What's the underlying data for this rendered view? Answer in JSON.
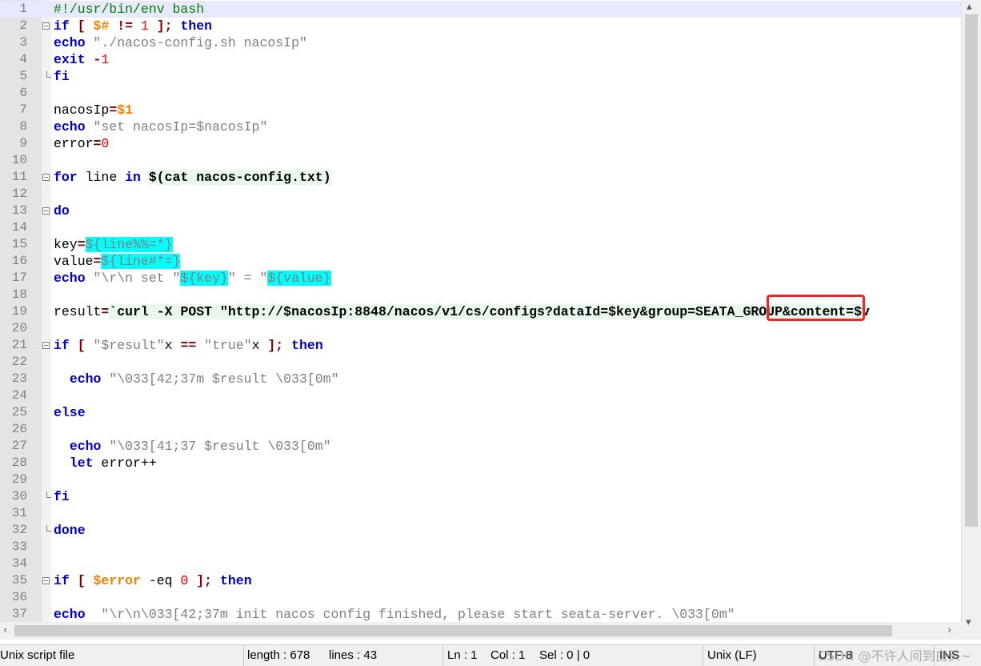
{
  "editor": {
    "lines": [
      {
        "n": "1",
        "tokens": [
          {
            "t": "#!/usr/bin/env bash",
            "c": "cmt"
          }
        ]
      },
      {
        "n": "2",
        "tokens": [
          {
            "t": "if",
            "c": "kw"
          },
          {
            "t": " [ ",
            "c": "op"
          },
          {
            "t": "$#",
            "c": "var"
          },
          {
            "t": " != ",
            "c": "op"
          },
          {
            "t": "1",
            "c": "num"
          },
          {
            "t": " ]; ",
            "c": "op"
          },
          {
            "t": "then",
            "c": "kw"
          }
        ]
      },
      {
        "n": "3",
        "tokens": [
          {
            "t": "echo",
            "c": "kw"
          },
          {
            "t": " \"./nacos-config.sh nacosIp\"",
            "c": "str"
          }
        ]
      },
      {
        "n": "4",
        "tokens": [
          {
            "t": "exit",
            "c": "kw"
          },
          {
            "t": " -",
            "c": "op"
          },
          {
            "t": "1",
            "c": "num"
          }
        ]
      },
      {
        "n": "5",
        "tokens": [
          {
            "t": "fi",
            "c": "kw"
          }
        ]
      },
      {
        "n": "6",
        "tokens": []
      },
      {
        "n": "7",
        "tokens": [
          {
            "t": "nacosIp",
            "c": ""
          },
          {
            "t": "=",
            "c": "op"
          },
          {
            "t": "$1",
            "c": "var"
          }
        ]
      },
      {
        "n": "8",
        "tokens": [
          {
            "t": "echo",
            "c": "kw"
          },
          {
            "t": " \"set nacosIp=$nacosIp\"",
            "c": "str"
          }
        ]
      },
      {
        "n": "9",
        "tokens": [
          {
            "t": "error",
            "c": ""
          },
          {
            "t": "=",
            "c": "op"
          },
          {
            "t": "0",
            "c": "num"
          }
        ]
      },
      {
        "n": "10",
        "tokens": []
      },
      {
        "n": "11",
        "tokens": [
          {
            "t": "for",
            "c": "kw"
          },
          {
            "t": " line ",
            "c": ""
          },
          {
            "t": "in",
            "c": "kw"
          },
          {
            "t": " ",
            "c": ""
          },
          {
            "t": "$(cat nacos-config.txt)",
            "c": "sub"
          }
        ]
      },
      {
        "n": "12",
        "tokens": []
      },
      {
        "n": "13",
        "tokens": [
          {
            "t": "do",
            "c": "kw"
          }
        ]
      },
      {
        "n": "14",
        "tokens": []
      },
      {
        "n": "15",
        "tokens": [
          {
            "t": "key",
            "c": ""
          },
          {
            "t": "=",
            "c": "op"
          },
          {
            "t": "${line%%=*}",
            "c": "hl"
          }
        ]
      },
      {
        "n": "16",
        "tokens": [
          {
            "t": "value",
            "c": ""
          },
          {
            "t": "=",
            "c": "op"
          },
          {
            "t": "${line#*=}",
            "c": "hl"
          }
        ]
      },
      {
        "n": "17",
        "tokens": [
          {
            "t": "echo",
            "c": "kw"
          },
          {
            "t": " \"\\r\\n set \"",
            "c": "str"
          },
          {
            "t": "${key}",
            "c": "hl"
          },
          {
            "t": "\" = \"",
            "c": "str"
          },
          {
            "t": "${value}",
            "c": "hl"
          }
        ]
      },
      {
        "n": "18",
        "tokens": []
      },
      {
        "n": "19",
        "tokens": [
          {
            "t": "result",
            "c": ""
          },
          {
            "t": "=",
            "c": "op"
          },
          {
            "t": "`curl -X POST \"http://$nacosIp:8848/nacos/v1/cs/configs?dataId=$key&group=SEATA_GROUP&content=$v",
            "c": "bt"
          }
        ]
      },
      {
        "n": "20",
        "tokens": []
      },
      {
        "n": "21",
        "tokens": [
          {
            "t": "if",
            "c": "kw"
          },
          {
            "t": " [ ",
            "c": "op"
          },
          {
            "t": "\"$result\"",
            "c": "str"
          },
          {
            "t": "x ",
            "c": ""
          },
          {
            "t": "==",
            "c": "op"
          },
          {
            "t": " \"true\"",
            "c": "str"
          },
          {
            "t": "x ",
            "c": ""
          },
          {
            "t": "]; ",
            "c": "op"
          },
          {
            "t": "then",
            "c": "kw"
          }
        ]
      },
      {
        "n": "22",
        "tokens": []
      },
      {
        "n": "23",
        "tokens": [
          {
            "t": "  ",
            "c": ""
          },
          {
            "t": "echo",
            "c": "kw"
          },
          {
            "t": " \"\\033[42;37m $result \\033[0m\"",
            "c": "str"
          }
        ]
      },
      {
        "n": "24",
        "tokens": []
      },
      {
        "n": "25",
        "tokens": [
          {
            "t": "else",
            "c": "kw"
          }
        ]
      },
      {
        "n": "26",
        "tokens": []
      },
      {
        "n": "27",
        "tokens": [
          {
            "t": "  ",
            "c": ""
          },
          {
            "t": "echo",
            "c": "kw"
          },
          {
            "t": " \"\\033[41;37 $result \\033[0m\"",
            "c": "str"
          }
        ]
      },
      {
        "n": "28",
        "tokens": [
          {
            "t": "  ",
            "c": ""
          },
          {
            "t": "let",
            "c": "kw"
          },
          {
            "t": " error++",
            "c": ""
          }
        ]
      },
      {
        "n": "29",
        "tokens": []
      },
      {
        "n": "30",
        "tokens": [
          {
            "t": "fi",
            "c": "kw"
          }
        ]
      },
      {
        "n": "31",
        "tokens": []
      },
      {
        "n": "32",
        "tokens": [
          {
            "t": "done",
            "c": "kw"
          }
        ]
      },
      {
        "n": "33",
        "tokens": []
      },
      {
        "n": "34",
        "tokens": []
      },
      {
        "n": "35",
        "tokens": [
          {
            "t": "if",
            "c": "kw"
          },
          {
            "t": " [ ",
            "c": "op"
          },
          {
            "t": "$error",
            "c": "var"
          },
          {
            "t": " -eq ",
            "c": ""
          },
          {
            "t": "0",
            "c": "num"
          },
          {
            "t": " ]; ",
            "c": "op"
          },
          {
            "t": "then",
            "c": "kw"
          }
        ]
      },
      {
        "n": "36",
        "tokens": []
      },
      {
        "n": "37",
        "tokens": [
          {
            "t": "echo",
            "c": "kw"
          },
          {
            "t": "  \"\\r\\n\\033[42;37m init nacos config finished, please start seata-server. \\033[0m\"",
            "c": "str"
          }
        ]
      }
    ],
    "current_line": "1"
  },
  "statusbar": {
    "file_type": "Unix script file",
    "length": "length : 678",
    "lines": "lines : 43",
    "ln": "Ln : 1",
    "col": "Col : 1",
    "sel": "Sel : 0 | 0",
    "eol": "Unix (LF)",
    "encoding": "UTF-8",
    "mode": "INS"
  },
  "watermark": "CSDN @不许人间到白头~",
  "colors": {
    "keyword": "#0000cc",
    "string": "#808080",
    "number": "#ff0000",
    "variable": "#ff8000",
    "operator": "#800000",
    "comment": "#008000",
    "highlight": "#00ffff",
    "annotation": "#ff2020"
  }
}
